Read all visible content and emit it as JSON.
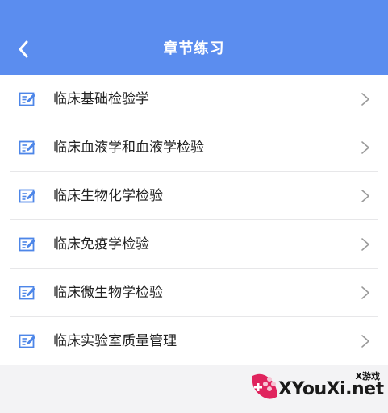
{
  "header": {
    "title": "章节练习",
    "back_icon": "back-arrow-icon",
    "background": "#5b8def"
  },
  "chapters": [
    {
      "label": "临床基础检验学",
      "icon": "edit-icon"
    },
    {
      "label": "临床血液学和血液学检验",
      "icon": "edit-icon"
    },
    {
      "label": "临床生物化学检验",
      "icon": "edit-icon"
    },
    {
      "label": "临床免疫学检验",
      "icon": "edit-icon"
    },
    {
      "label": "临床微生物学检验",
      "icon": "edit-icon"
    },
    {
      "label": "临床实验室质量管理",
      "icon": "edit-icon"
    }
  ],
  "watermark": {
    "small_text": "X游戏",
    "big_text": "XYouXi.net"
  },
  "colors": {
    "accent": "#5b8def",
    "icon": "#4d86e8",
    "chevron": "#9a9a9a"
  }
}
